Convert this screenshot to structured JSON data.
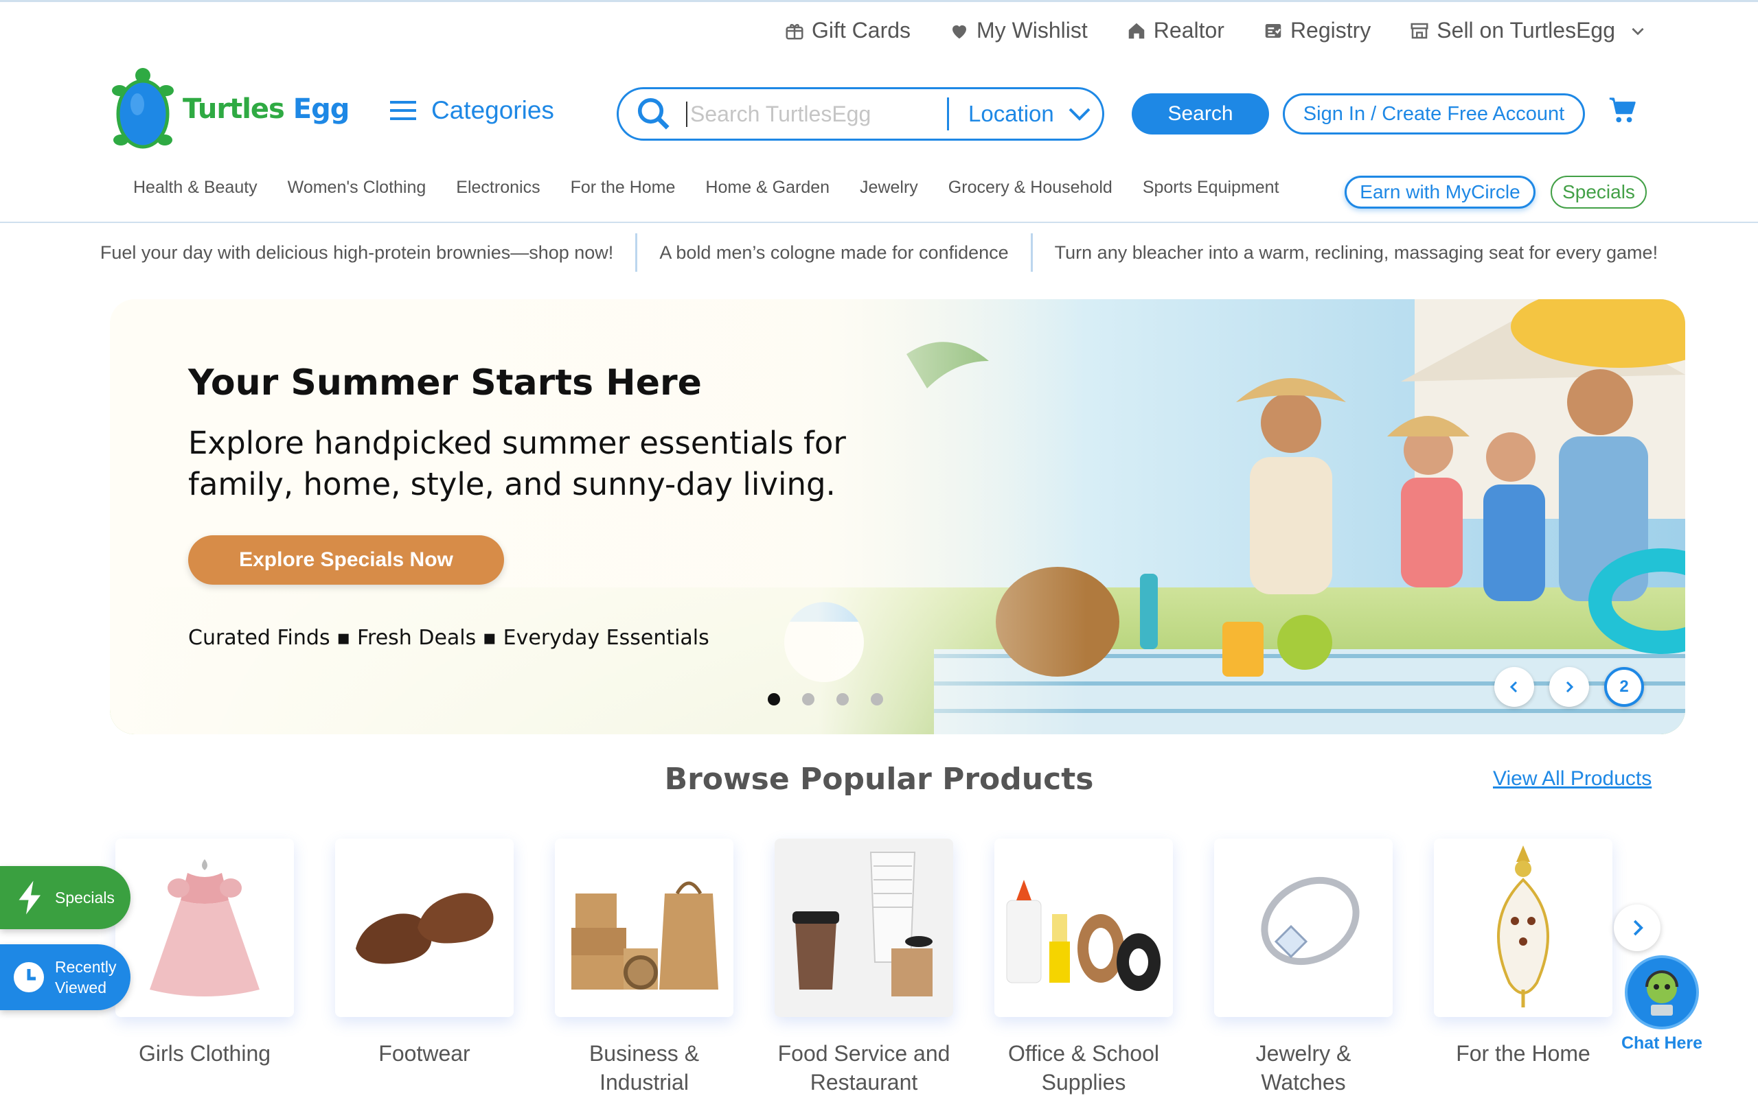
{
  "utility": [
    {
      "label": "Gift Cards",
      "icon": "gift-icon"
    },
    {
      "label": "My Wishlist",
      "icon": "heart-icon"
    },
    {
      "label": "Realtor",
      "icon": "home-icon"
    },
    {
      "label": "Registry",
      "icon": "registry-icon"
    },
    {
      "label": "Sell on TurtlesEgg",
      "icon": "store-icon"
    }
  ],
  "logo": {
    "part1": "Turtles",
    "part2": " Egg"
  },
  "categories_label": "Categories",
  "search": {
    "placeholder": "Search TurtlesEgg",
    "location": "Location",
    "button": "Search"
  },
  "signin": "Sign In / Create Free Account",
  "catnav": [
    "Health & Beauty",
    "Women's Clothing",
    "Electronics",
    "For the Home",
    "Home & Garden",
    "Jewelry",
    "Grocery & Household",
    "Sports Equipment"
  ],
  "pills": {
    "earn": "Earn with MyCircle",
    "specials": "Specials"
  },
  "promos": [
    "Fuel your day with delicious high-protein brownies—shop now!",
    "A bold men’s cologne made for confidence",
    "Turn any bleacher into a warm, reclining, massaging seat for every game!"
  ],
  "hero": {
    "title": "Your Summer Starts Here",
    "subtitle": "Explore handpicked summer essentials for family, home, style, and sunny-day living.",
    "cta": "Explore Specials Now",
    "tags": "Curated Finds ▪ Fresh Deals ▪ Everyday Essentials",
    "slide_count": 4,
    "active_slide": 1,
    "slide_number": "2"
  },
  "browse": {
    "title": "Browse Popular Products",
    "view_all": "View All Products",
    "products": [
      {
        "name": "Girls Clothing",
        "icon": "dress-icon"
      },
      {
        "name": "Footwear",
        "icon": "shoes-icon"
      },
      {
        "name": "Business & Industrial",
        "icon": "boxes-icon"
      },
      {
        "name": "Food Service and Restaurant",
        "icon": "cups-icon"
      },
      {
        "name": "Office & School Supplies",
        "icon": "glue-tape-icon"
      },
      {
        "name": "Jewelry & Watches",
        "icon": "ring-icon"
      },
      {
        "name": "For the Home",
        "icon": "ornament-icon"
      }
    ]
  },
  "side": {
    "specials": "Specials",
    "recent_line1": "Recently",
    "recent_line2": "Viewed"
  },
  "chat_label": "Chat Here",
  "colors": {
    "brand_blue": "#1e88e5",
    "brand_green": "#43a047",
    "cta_orange": "#d78c48"
  }
}
